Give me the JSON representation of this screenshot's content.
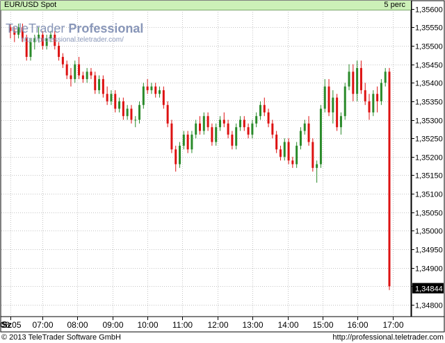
{
  "header": {
    "symbol": "EUR/USD Spot",
    "interval": "5 perc"
  },
  "brand": {
    "name_light": "TeleTrader",
    "name_bold": "Professional",
    "url": "http://professional.teletrader.com/"
  },
  "footer": {
    "copyright": "© 2013 TeleTrader Software GmbH",
    "url": "http://professional.teletrader.com"
  },
  "day_label": "Sz",
  "colors": {
    "up": "#2a8a2a",
    "down": "#dd1111",
    "header_bg": "#ccf0b8",
    "grid": "#c4c4c4"
  },
  "chart_data": {
    "type": "candlestick",
    "title": "EUR/USD Spot",
    "interval": "5 perc",
    "last_price": "1,34844",
    "x_ticks": [
      "06:05",
      "07:00",
      "08:00",
      "09:00",
      "10:00",
      "11:00",
      "12:00",
      "13:00",
      "14:00",
      "15:00",
      "16:00",
      "17:00"
    ],
    "x_tick_minutes": [
      365,
      420,
      480,
      540,
      600,
      660,
      720,
      780,
      840,
      900,
      960,
      1020
    ],
    "xlim": [
      350,
      1050
    ],
    "y_ticks": [
      "1,35600",
      "1,35550",
      "1,35500",
      "1,35450",
      "1,35400",
      "1,35350",
      "1,35300",
      "1,35250",
      "1,35200",
      "1,35150",
      "1,35100",
      "1,35050",
      "1,35000",
      "1,34950",
      "1,34900",
      "1,34850",
      "1,34800"
    ],
    "y_tick_values": [
      1.356,
      1.3555,
      1.355,
      1.3545,
      1.354,
      1.3535,
      1.353,
      1.3525,
      1.352,
      1.3515,
      1.351,
      1.3505,
      1.35,
      1.3495,
      1.349,
      1.3485,
      1.348
    ],
    "ylim": [
      1.3477,
      1.3562
    ],
    "grid": true,
    "candles_ohlc": [
      [
        1.3555,
        1.3556,
        1.3552,
        1.3554
      ],
      [
        1.3554,
        1.3555,
        1.3551,
        1.3553
      ],
      [
        1.3553,
        1.3556,
        1.3552,
        1.3555
      ],
      [
        1.3555,
        1.3556,
        1.3551,
        1.3552
      ],
      [
        1.3552,
        1.3553,
        1.3546,
        1.3547
      ],
      [
        1.3547,
        1.3552,
        1.3546,
        1.3551
      ],
      [
        1.3551,
        1.3553,
        1.3549,
        1.3552
      ],
      [
        1.3552,
        1.3555,
        1.3551,
        1.3553
      ],
      [
        1.3553,
        1.3554,
        1.3549,
        1.355
      ],
      [
        1.355,
        1.3553,
        1.3549,
        1.3552
      ],
      [
        1.3552,
        1.3554,
        1.3551,
        1.3553
      ],
      [
        1.3553,
        1.3554,
        1.3549,
        1.355
      ],
      [
        1.355,
        1.3551,
        1.3546,
        1.3547
      ],
      [
        1.3547,
        1.3548,
        1.3544,
        1.3545
      ],
      [
        1.3545,
        1.3546,
        1.3541,
        1.3542
      ],
      [
        1.3542,
        1.3544,
        1.3539,
        1.3541
      ],
      [
        1.3541,
        1.3546,
        1.354,
        1.3545
      ],
      [
        1.3545,
        1.3547,
        1.3541,
        1.3542
      ],
      [
        1.3542,
        1.3543,
        1.354,
        1.3541
      ],
      [
        1.3541,
        1.3544,
        1.354,
        1.3543
      ],
      [
        1.3543,
        1.3544,
        1.3541,
        1.3542
      ],
      [
        1.3542,
        1.3543,
        1.3537,
        1.3538
      ],
      [
        1.3538,
        1.3542,
        1.3537,
        1.3541
      ],
      [
        1.3541,
        1.3542,
        1.3536,
        1.3537
      ],
      [
        1.3537,
        1.3539,
        1.3534,
        1.3535
      ],
      [
        1.3535,
        1.3538,
        1.3534,
        1.3537
      ],
      [
        1.3537,
        1.3538,
        1.3532,
        1.3533
      ],
      [
        1.3533,
        1.3536,
        1.3532,
        1.3535
      ],
      [
        1.3535,
        1.3536,
        1.353,
        1.3531
      ],
      [
        1.3531,
        1.3534,
        1.353,
        1.3533
      ],
      [
        1.3533,
        1.3534,
        1.3529,
        1.353
      ],
      [
        1.353,
        1.3531,
        1.3528,
        1.353
      ],
      [
        1.353,
        1.3535,
        1.3529,
        1.3534
      ],
      [
        1.3534,
        1.354,
        1.3533,
        1.3539
      ],
      [
        1.3539,
        1.3541,
        1.3537,
        1.3538
      ],
      [
        1.3538,
        1.354,
        1.3537,
        1.3539
      ],
      [
        1.3539,
        1.354,
        1.3536,
        1.3537
      ],
      [
        1.3537,
        1.3539,
        1.3536,
        1.3538
      ],
      [
        1.3538,
        1.3539,
        1.3533,
        1.3534
      ],
      [
        1.3534,
        1.3535,
        1.3528,
        1.3529
      ],
      [
        1.3529,
        1.353,
        1.3521,
        1.3522
      ],
      [
        1.3522,
        1.3523,
        1.3516,
        1.3518
      ],
      [
        1.3518,
        1.3524,
        1.3517,
        1.3523
      ],
      [
        1.3523,
        1.3527,
        1.3522,
        1.3526
      ],
      [
        1.3526,
        1.3527,
        1.3521,
        1.3522
      ],
      [
        1.3522,
        1.3527,
        1.3521,
        1.3526
      ],
      [
        1.3526,
        1.353,
        1.3525,
        1.3529
      ],
      [
        1.3529,
        1.3531,
        1.3526,
        1.3527
      ],
      [
        1.3527,
        1.3532,
        1.3526,
        1.3531
      ],
      [
        1.3531,
        1.3532,
        1.3527,
        1.3528
      ],
      [
        1.3528,
        1.3529,
        1.3523,
        1.3524
      ],
      [
        1.3524,
        1.3529,
        1.3523,
        1.3528
      ],
      [
        1.3528,
        1.3531,
        1.3527,
        1.353
      ],
      [
        1.353,
        1.3532,
        1.3528,
        1.3529
      ],
      [
        1.3529,
        1.353,
        1.3525,
        1.3526
      ],
      [
        1.3526,
        1.3527,
        1.3522,
        1.3523
      ],
      [
        1.3523,
        1.3529,
        1.3522,
        1.3528
      ],
      [
        1.3528,
        1.3531,
        1.3527,
        1.353
      ],
      [
        1.353,
        1.3531,
        1.3527,
        1.3528
      ],
      [
        1.3528,
        1.3529,
        1.3525,
        1.3526
      ],
      [
        1.3526,
        1.353,
        1.3525,
        1.3529
      ],
      [
        1.3529,
        1.3532,
        1.3528,
        1.3531
      ],
      [
        1.3531,
        1.3535,
        1.353,
        1.3534
      ],
      [
        1.3534,
        1.3536,
        1.3531,
        1.3532
      ],
      [
        1.3532,
        1.3533,
        1.3528,
        1.3529
      ],
      [
        1.3529,
        1.353,
        1.3525,
        1.3526
      ],
      [
        1.3526,
        1.3527,
        1.3521,
        1.3522
      ],
      [
        1.3522,
        1.3523,
        1.3519,
        1.352
      ],
      [
        1.352,
        1.3525,
        1.3519,
        1.3524
      ],
      [
        1.3524,
        1.3525,
        1.3518,
        1.3519
      ],
      [
        1.3519,
        1.352,
        1.3517,
        1.3518
      ],
      [
        1.3518,
        1.3524,
        1.3517,
        1.3523
      ],
      [
        1.3523,
        1.3528,
        1.3522,
        1.3527
      ],
      [
        1.3527,
        1.353,
        1.3526,
        1.3529
      ],
      [
        1.3529,
        1.3531,
        1.3523,
        1.3524
      ],
      [
        1.3524,
        1.3525,
        1.3516,
        1.3517
      ],
      [
        1.3517,
        1.3519,
        1.3513,
        1.3518
      ],
      [
        1.3518,
        1.3534,
        1.3517,
        1.3533
      ],
      [
        1.3533,
        1.3541,
        1.3532,
        1.3539
      ],
      [
        1.3539,
        1.3541,
        1.3531,
        1.3532
      ],
      [
        1.3532,
        1.3538,
        1.3529,
        1.3536
      ],
      [
        1.3536,
        1.3537,
        1.3527,
        1.3528
      ],
      [
        1.3528,
        1.3532,
        1.3526,
        1.3531
      ],
      [
        1.3531,
        1.354,
        1.353,
        1.3539
      ],
      [
        1.3539,
        1.3545,
        1.3538,
        1.3543
      ],
      [
        1.3543,
        1.3545,
        1.3535,
        1.3537
      ],
      [
        1.3537,
        1.3546,
        1.3535,
        1.3544
      ],
      [
        1.3544,
        1.3546,
        1.3537,
        1.3538
      ],
      [
        1.3538,
        1.354,
        1.3534,
        1.3535
      ],
      [
        1.3535,
        1.3537,
        1.353,
        1.3532
      ],
      [
        1.3532,
        1.3538,
        1.3531,
        1.3537
      ],
      [
        1.3537,
        1.3539,
        1.3532,
        1.3535
      ],
      [
        1.3535,
        1.3541,
        1.3534,
        1.354
      ],
      [
        1.354,
        1.3544,
        1.3539,
        1.3543
      ],
      [
        1.3543,
        1.3544,
        1.3484,
        1.3485
      ]
    ]
  }
}
